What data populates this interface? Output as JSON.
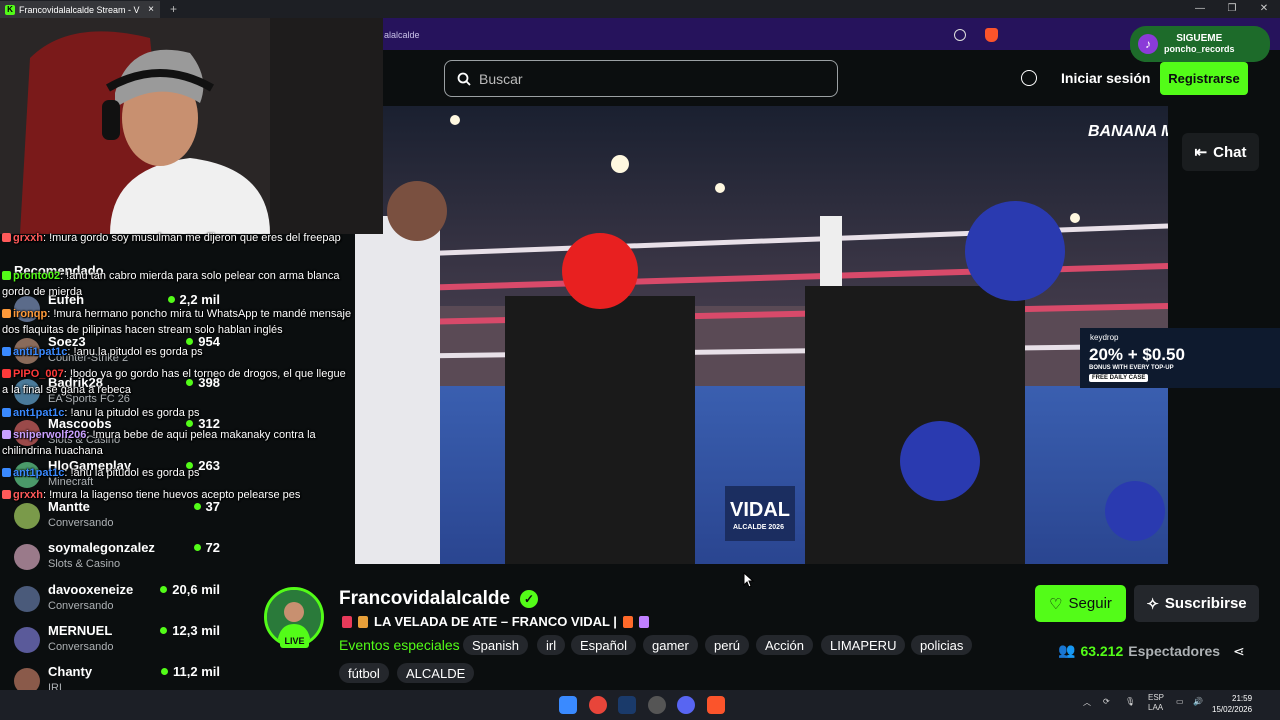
{
  "browser": {
    "tab_title": "Francovidalalcalde Stream - V",
    "tab_close": "×",
    "new_tab": "+",
    "address_fragment": "alalcalde",
    "window_controls": [
      "—",
      "❐",
      "✕"
    ]
  },
  "header": {
    "search_placeholder": "Buscar",
    "login_label": "Iniciar sesión",
    "register_label": "Registrarse"
  },
  "overlay": {
    "tiktok_title": "SIGUEME",
    "tiktok_handle": "poncho_records",
    "video_watermark": "BANANA MEDIA",
    "promo_brand": "keydrop",
    "promo_big": "20% + $0.50",
    "promo_sub": "BONUS WITH EVERY TOP-UP",
    "promo_cta": "FREE DAILY CASE",
    "video_banner": "VIDAL",
    "video_banner_sub": "ALCALDE 2026"
  },
  "player": {
    "chat_label": "Chat"
  },
  "sidebar": {
    "title": "Recomendado",
    "items": [
      {
        "name": "Eufeh",
        "category": "",
        "viewers": "2,2 mil",
        "color": "#5b6b8a"
      },
      {
        "name": "Soez3",
        "category": "Counter-Strike 2",
        "viewers": "954",
        "color": "#8a6b5b"
      },
      {
        "name": "Badrik28",
        "category": "EA Sports FC 26",
        "viewers": "398",
        "color": "#4a7a9a"
      },
      {
        "name": "Mascoobs",
        "category": "Slots & Casino",
        "viewers": "312",
        "color": "#9a4a4a"
      },
      {
        "name": "HloGameplay",
        "category": "Minecraft",
        "viewers": "263",
        "color": "#4a9a6a"
      },
      {
        "name": "Mantte",
        "category": "Conversando",
        "viewers": "37",
        "color": "#7a9a4a"
      },
      {
        "name": "soymalegonzalez",
        "category": "Slots & Casino",
        "viewers": "72",
        "color": "#9a7a8a"
      },
      {
        "name": "davooxeneize",
        "category": "Conversando",
        "viewers": "20,6 mil",
        "color": "#4a5a7a"
      },
      {
        "name": "MERNUEL",
        "category": "Conversando",
        "viewers": "12,3 mil",
        "color": "#5a5a9a"
      },
      {
        "name": "Chanty",
        "category": "IRL",
        "viewers": "11,2 mil",
        "color": "#8a5a4a"
      }
    ]
  },
  "chat_overlay": [
    {
      "user": "grxxh",
      "color": "#ff5a5a",
      "text": ": !mura gordo soy musulman me dijeron que eres del freepap"
    },
    {
      "user": "pronto02",
      "color": "#53fc18",
      "text": ": !anu tan cabro mierda para solo pelear con arma blanca gordo de mierda"
    },
    {
      "user": "ironqp",
      "color": "#ff9a3a",
      "text": ": !mura hermano poncho mira tu WhatsApp te mandé mensaje dos flaquitas de pilipinas hacen stream solo hablan inglés"
    },
    {
      "user": "anti1pat1c",
      "color": "#3a8aff",
      "text": ": !anu la pitudol es gorda ps"
    },
    {
      "user": "PIPO_007",
      "color": "#ff3a3a",
      "text": ": !bodo ya go gordo has el torneo de drogos, el que llegue a la final se gana a rebeca"
    },
    {
      "user": "ant1pat1c",
      "color": "#3a8aff",
      "text": ": !anu la pitudol es gorda ps"
    },
    {
      "user": "sniperwolf206",
      "color": "#c9a0ff",
      "text": ": !mura bebe de aqui pelea makanaky contra la chilindrina huachana"
    },
    {
      "user": "ant1pat1c",
      "color": "#3a8aff",
      "text": ": !anu la pitudol es gorda ps"
    },
    {
      "user": "grxxh",
      "color": "#ff5a5a",
      "text": ": !mura la liagenso tiene huevos acepto pelearse pes"
    }
  ],
  "channel": {
    "name": "Francovidalalcalde",
    "live_label": "LIVE",
    "stream_title": "LA VELADA DE ATE – FRANCO VIDAL |",
    "category": "Eventos especiales",
    "tags": [
      "Spanish",
      "irl",
      "Español",
      "gamer",
      "perú",
      "Acción",
      "LIMAPERU",
      "policias",
      "fútbol",
      "ALCALDE"
    ],
    "follow_label": "Seguir",
    "subscribe_label": "Suscribirse",
    "viewers_count": "63.212",
    "viewers_label": "Espectadores"
  },
  "taskbar": {
    "lang_top": "ESP",
    "lang_bottom": "LAA",
    "time": "21:59",
    "date": "15/02/2026"
  },
  "colors": {
    "accent": "#53fc18",
    "background": "#0b0e0f",
    "tag_bg": "#24272c"
  }
}
